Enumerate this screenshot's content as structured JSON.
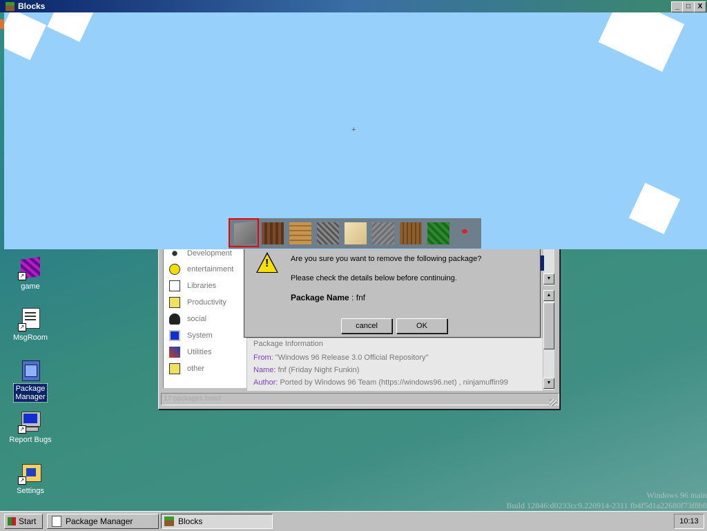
{
  "desktop": {
    "icons": [
      {
        "label": "game"
      },
      {
        "label": "MsgRoom"
      },
      {
        "label": "Package\nManager"
      },
      {
        "label": "Report Bugs"
      },
      {
        "label": "Settings"
      }
    ],
    "watermark_line1": "Windows 96 main",
    "watermark_line2": "Build 12846:d0233cc9.220914-2311 fb4f5d1a22680f73f8b8"
  },
  "blocks_window": {
    "title": "Blocks",
    "minimize": "_",
    "maximize": "□",
    "close": "X",
    "crosshair": "+",
    "hotbar_selected_index": 0,
    "hotbar": [
      "stone",
      "dirt",
      "planks",
      "cobblestone",
      "sand",
      "gravel",
      "wood",
      "leaves",
      "flower"
    ],
    "colors": {
      "sky": "#97d0fb",
      "hotbar": "#6e7f8b",
      "selection": "#e00000"
    }
  },
  "package_manager": {
    "categories": [
      "Development",
      "entertainment",
      "Libraries",
      "Productivity",
      "social",
      "System",
      "Utilities",
      "other"
    ],
    "info": {
      "header": "Package Information",
      "from_label": "From:",
      "from_value": "\"Windows 96 Release 3.0 Official Repository\"",
      "name_label": "Name:",
      "name_value": "fnf (Friday Night Funkin)",
      "author_label": "Author:",
      "author_value": "Ported by Windows 96 Team (https://windows96.net) , ninjamuffin99"
    },
    "status": "17 packages listed"
  },
  "dialog": {
    "question": "Are you sure you want to remove the following package?",
    "hint": "Please check the details below before continuing.",
    "package_name_label": "Package Name",
    "package_name_value": " : fnf",
    "cancel": "cancel",
    "ok": "OK"
  },
  "taskbar": {
    "start": "Start",
    "tasks": [
      {
        "label": "Package Manager"
      },
      {
        "label": "Blocks",
        "active": true
      }
    ],
    "clock": "10:13"
  }
}
